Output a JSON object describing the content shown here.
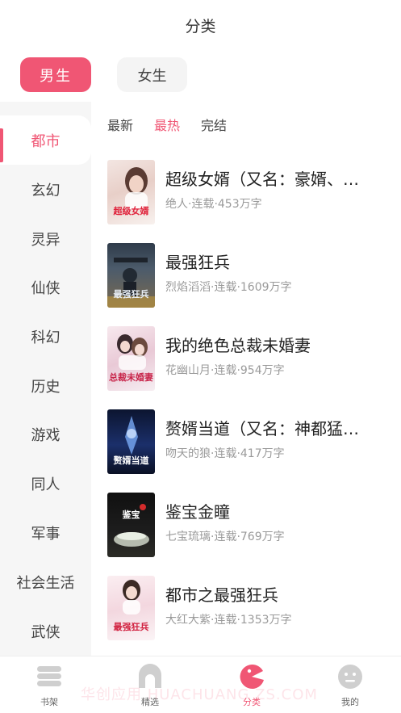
{
  "header": {
    "title": "分类"
  },
  "gender": {
    "male": "男生",
    "female": "女生"
  },
  "sidebar": {
    "items": [
      {
        "label": "都市"
      },
      {
        "label": "玄幻"
      },
      {
        "label": "灵异"
      },
      {
        "label": "仙侠"
      },
      {
        "label": "科幻"
      },
      {
        "label": "历史"
      },
      {
        "label": "游戏"
      },
      {
        "label": "同人"
      },
      {
        "label": "军事"
      },
      {
        "label": "社会生活"
      },
      {
        "label": "武侠"
      }
    ]
  },
  "tabs": {
    "newest": "最新",
    "hottest": "最热",
    "finished": "完结"
  },
  "books": [
    {
      "title": "超级女婿（又名：豪婿、…",
      "meta": "绝人·连载·453万字",
      "cover_text": "超级女婿"
    },
    {
      "title": "最强狂兵",
      "meta": "烈焰滔滔·连载·1609万字",
      "cover_text": "最强狂兵"
    },
    {
      "title": "我的绝色总裁未婚妻",
      "meta": "花幽山月·连载·954万字",
      "cover_text": "总裁未婚妻"
    },
    {
      "title": "赘婿当道（又名：神都猛…",
      "meta": "吻天的狼·连载·417万字",
      "cover_text": "赘婿当道"
    },
    {
      "title": "鉴宝金瞳",
      "meta": "七宝琉璃·连载·769万字",
      "cover_text": "鉴宝"
    },
    {
      "title": "都市之最强狂兵",
      "meta": "大红大紫·连载·1353万字",
      "cover_text": "最强狂兵"
    }
  ],
  "tabbar": {
    "bookshelf": "书架",
    "featured": "精选",
    "category": "分类",
    "mine": "我的"
  },
  "watermark": "华创应用 HUACHUANG ZS.COM",
  "colors": {
    "accent": "#f05674"
  }
}
